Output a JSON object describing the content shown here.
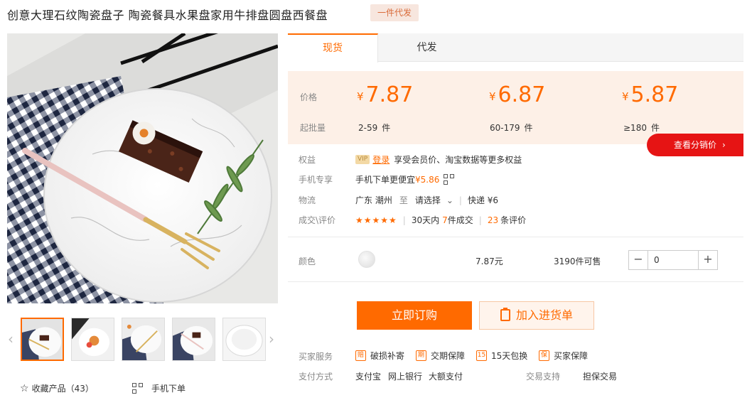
{
  "product": {
    "title": "创意大理石纹陶瓷盘子 陶瓷餐具水果盘家用牛排盘圆盘西餐盘",
    "badge": "一件代发"
  },
  "tabs": [
    {
      "label": "现货"
    },
    {
      "label": "代发"
    }
  ],
  "price": {
    "price_label": "价格",
    "moq_label": "起批量",
    "currency": "¥",
    "tiers": [
      {
        "price": "7.87",
        "qty": "2-59",
        "unit": "件"
      },
      {
        "price": "6.87",
        "qty": "60-179",
        "unit": "件"
      },
      {
        "price": "5.87",
        "qty": "≥180",
        "unit": "件"
      }
    ],
    "distributor_button": "查看分销价",
    "distributor_arrow": "›"
  },
  "rights": {
    "label": "权益",
    "vip": "VIP",
    "login": "登录",
    "text": "享受会员价、淘宝数据等更多权益"
  },
  "mobile": {
    "label": "手机专享",
    "text": "手机下单更便宜",
    "price": "¥5.86"
  },
  "logistics": {
    "label": "物流",
    "origin": "广东 潮州",
    "to": "至",
    "select": "请选择",
    "shipping": "快递 ¥6"
  },
  "reviews": {
    "label": "成交\\评价",
    "stars": "★★★★★",
    "deals_prefix": "30天内",
    "deals_count": "7",
    "deals_suffix": "件成交",
    "review_count": "23",
    "review_suffix": "条评价"
  },
  "color_row": {
    "label": "颜色",
    "price": "7.87元",
    "stock": "3190件可售",
    "minus": "−",
    "plus": "+",
    "quantity": "0"
  },
  "actions": {
    "order": "立即订购",
    "add_cart": "加入进货单"
  },
  "buyer_services": {
    "label": "买家服务",
    "items": [
      {
        "icon": "赔",
        "text": "破损补寄"
      },
      {
        "icon": "期",
        "text": "交期保障"
      },
      {
        "icon": "15",
        "text": "15天包换"
      },
      {
        "icon": "保",
        "text": "买家保障"
      }
    ]
  },
  "payment": {
    "label": "支付方式",
    "methods": [
      "支付宝",
      "网上银行",
      "大额支付"
    ],
    "support_label": "交易支持",
    "support_value": "担保交易"
  },
  "gallery": {
    "prev": "‹",
    "next": "›",
    "favorite_star": "☆",
    "favorite_text": "收藏产品（43）",
    "phone_order": "手机下单"
  }
}
